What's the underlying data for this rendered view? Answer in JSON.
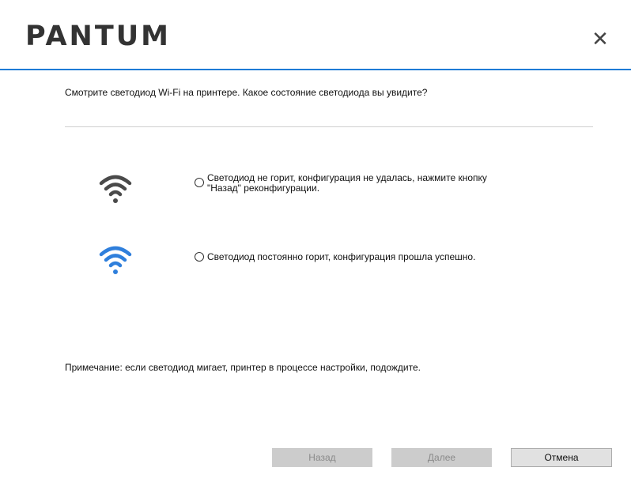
{
  "header": {
    "logo_text": "PANTUM",
    "close_glyph": "✕"
  },
  "question": "Смотрите светодиод Wi-Fi на принтере. Какое состояние светодиода вы увидите?",
  "options": [
    {
      "icon": "wifi-off-icon",
      "icon_color": "#4a4a4a",
      "line1": "Светодиод не горит,  конфигурация не удалась, нажмите кнопку",
      "line2": "\"Назад\" реконфигурации.",
      "selected": false
    },
    {
      "icon": "wifi-on-icon",
      "icon_color": "#2f7fdc",
      "line1": "Светодиод постоянно горит, конфигурация прошла успешно.",
      "selected": false
    }
  ],
  "note": "Примечание: если светодиод мигает, принтер в процессе настройки, подождите.",
  "buttons": {
    "back": "Назад",
    "next": "Далее",
    "cancel": "Отмена"
  },
  "colors": {
    "accent": "#1e7bd6",
    "disabled_button": "#cccccc"
  }
}
